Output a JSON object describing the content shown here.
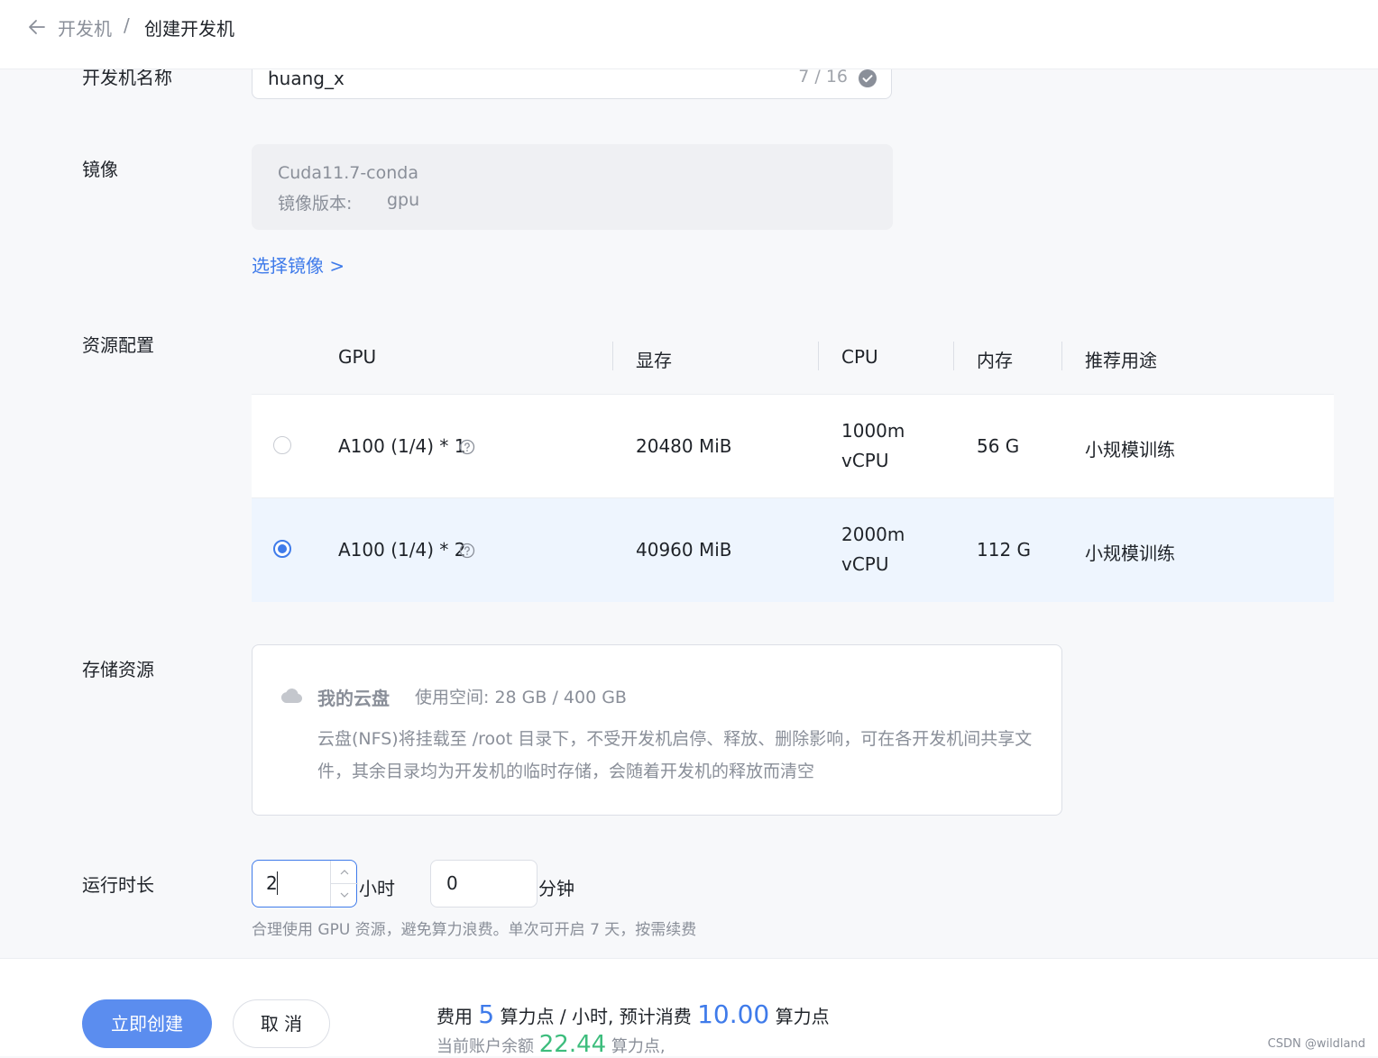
{
  "breadcrumb": {
    "parent": "开发机",
    "separator": "/",
    "current": "创建开发机"
  },
  "form": {
    "name_label": "开发机名称",
    "name_value": "huang_x",
    "name_count": "7 / 16",
    "image_label": "镜像",
    "image_name": "Cuda11.7-conda",
    "image_version_label": "镜像版本:",
    "image_version_value": "gpu",
    "select_image_link": "选择镜像 >",
    "resource_label": "资源配置",
    "storage_label": "存储资源",
    "duration_label": "运行时长"
  },
  "resource_table": {
    "headers": [
      "GPU",
      "显存",
      "CPU",
      "内存",
      "推荐用途"
    ],
    "rows": [
      {
        "gpu": "A100 (1/4) * 1",
        "vram": "20480 MiB",
        "cpu_line1": "1000m",
        "cpu_line2": "vCPU",
        "mem": "56 G",
        "use": "小规模训练",
        "selected": false
      },
      {
        "gpu": "A100 (1/4) * 2",
        "vram": "40960 MiB",
        "cpu_line1": "2000m",
        "cpu_line2": "vCPU",
        "mem": "112 G",
        "use": "小规模训练",
        "selected": true
      }
    ]
  },
  "storage": {
    "title": "我的云盘",
    "usage": "使用空间: 28 GB / 400 GB",
    "description": "云盘(NFS)将挂载至 /root 目录下，不受开发机启停、释放、删除影响，可在各开发机间共享文件，其余目录均为开发机的临时存储，会随着开发机的释放而清空"
  },
  "duration": {
    "hours_value": "2",
    "hours_unit": "小时",
    "minutes_value": "0",
    "minutes_unit": "分钟",
    "hint": "合理使用 GPU 资源，避免算力浪费。单次可开启 7 天，按需续费"
  },
  "footer": {
    "create_button": "立即创建",
    "cancel_button": "取 消",
    "fee_label": "费用",
    "fee_rate": "5",
    "fee_rate_unit": "算力点 / 小时, 预计消费",
    "fee_total": "10.00",
    "fee_total_unit": "算力点",
    "balance_label": "当前账户余额",
    "balance_value": "22.44",
    "balance_unit": "算力点,"
  },
  "watermark": "CSDN @wildland",
  "colors": {
    "accent": "#3f7bea",
    "button": "#5b8def",
    "balance": "#3dbd7d",
    "selected_row": "#eef5fe"
  }
}
